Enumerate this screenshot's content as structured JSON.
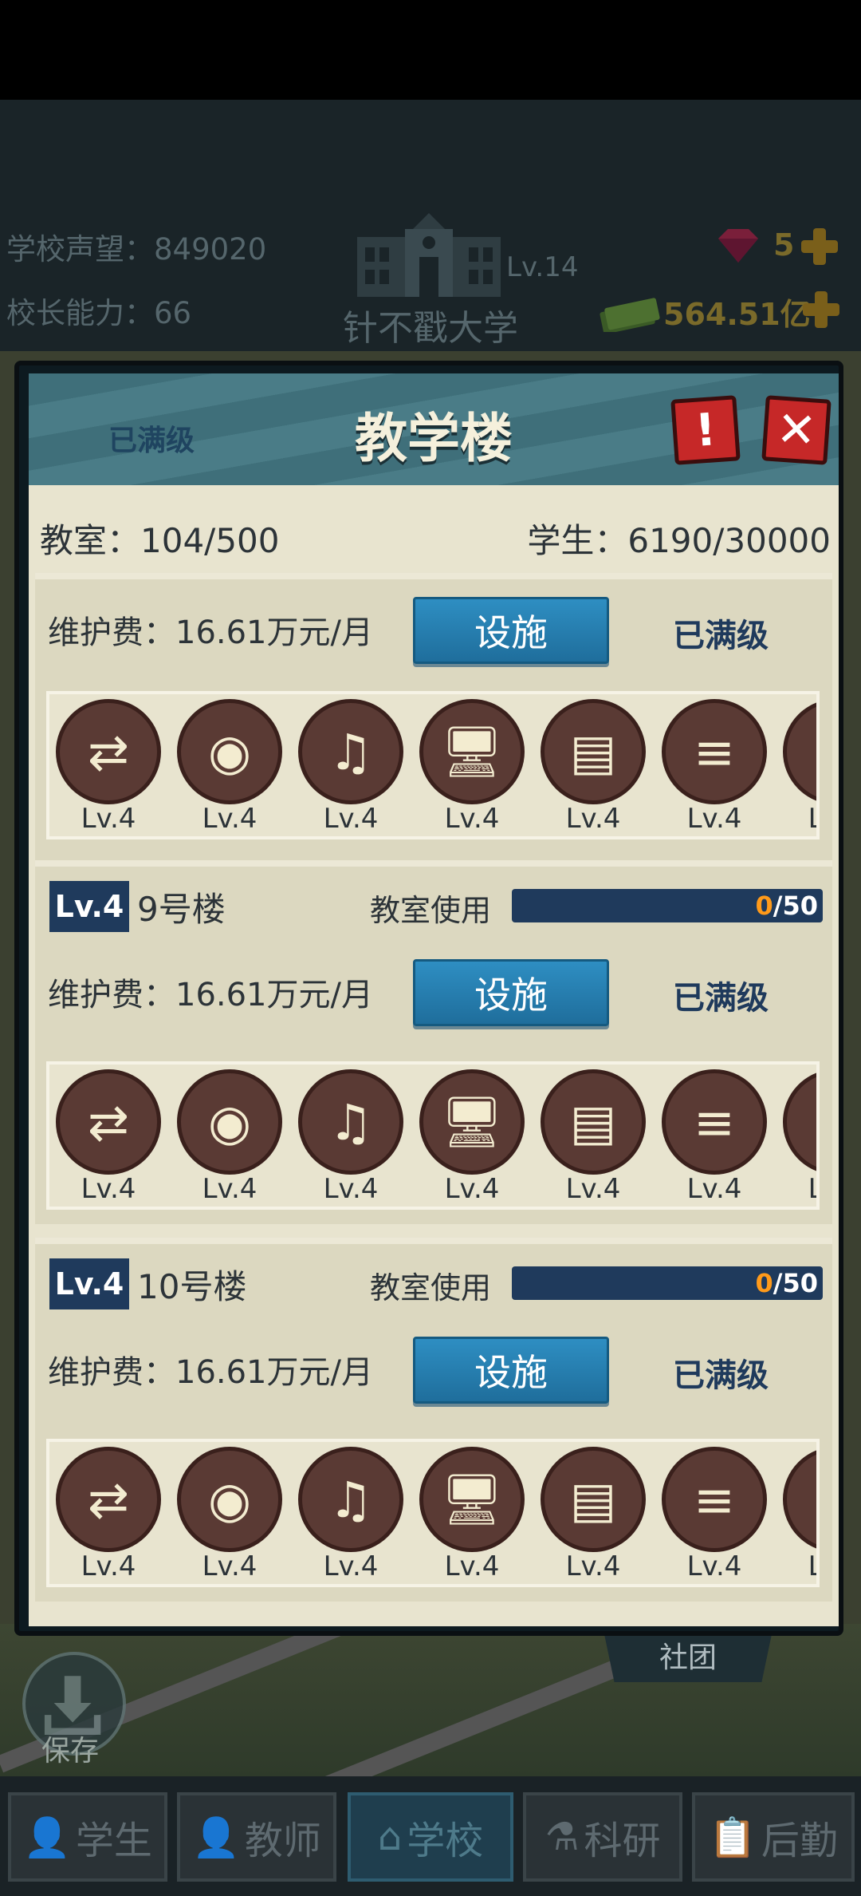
{
  "header": {
    "reputation_label": "学校声望：",
    "reputation_value": "849020",
    "ability_label": "校长能力：",
    "ability_value": "66",
    "school_level": "Lv.14",
    "school_name": "针不戳大学",
    "gems": "5",
    "cash": "564.51亿",
    "gem_icon": "gem-icon",
    "cash_icon": "cash-icon"
  },
  "panel": {
    "status_left": "已满级",
    "title": "教学楼",
    "alert_label": "!",
    "close_label": "✕",
    "summary": {
      "classrooms_label": "教室：",
      "classrooms_value": "104/500",
      "students_label": "学生：",
      "students_value": "6190/30000"
    },
    "facility_icons": [
      "video-switch-icon",
      "broadcast-antenna-icon",
      "media-icon",
      "computer-icon",
      "cabinet-icon",
      "air-conditioner-icon",
      "more-icon"
    ],
    "facility_level": "Lv.4",
    "cards": [
      {
        "fee": "维护费：16.61万元/月",
        "button": "设施",
        "status": "已满级"
      },
      {
        "level": "Lv.4",
        "name": "9号楼",
        "usage_label": "教室使用",
        "usage_current": "0",
        "usage_total": "/50",
        "usage_fraction": 0,
        "fee": "维护费：16.61万元/月",
        "button": "设施",
        "status": "已满级"
      },
      {
        "level": "Lv.4",
        "name": "10号楼",
        "usage_label": "教室使用",
        "usage_current": "0",
        "usage_total": "/50",
        "usage_fraction": 0,
        "fee": "维护费：16.61万元/月",
        "button": "设施",
        "status": "已满级"
      }
    ]
  },
  "map": {
    "save_label": "保存",
    "club_label": "社团"
  },
  "nav": [
    {
      "label": "学生",
      "icon": "student-icon"
    },
    {
      "label": "教师",
      "icon": "teacher-icon"
    },
    {
      "label": "学校",
      "icon": "school-icon"
    },
    {
      "label": "科研",
      "icon": "flask-icon"
    },
    {
      "label": "后勤",
      "icon": "clipboard-icon"
    }
  ],
  "colors": {
    "accent_blue": "#1f3a5c",
    "button_blue": "#2e8ec2",
    "close_red": "#c62828",
    "usage_orange": "#ff9a1a"
  }
}
